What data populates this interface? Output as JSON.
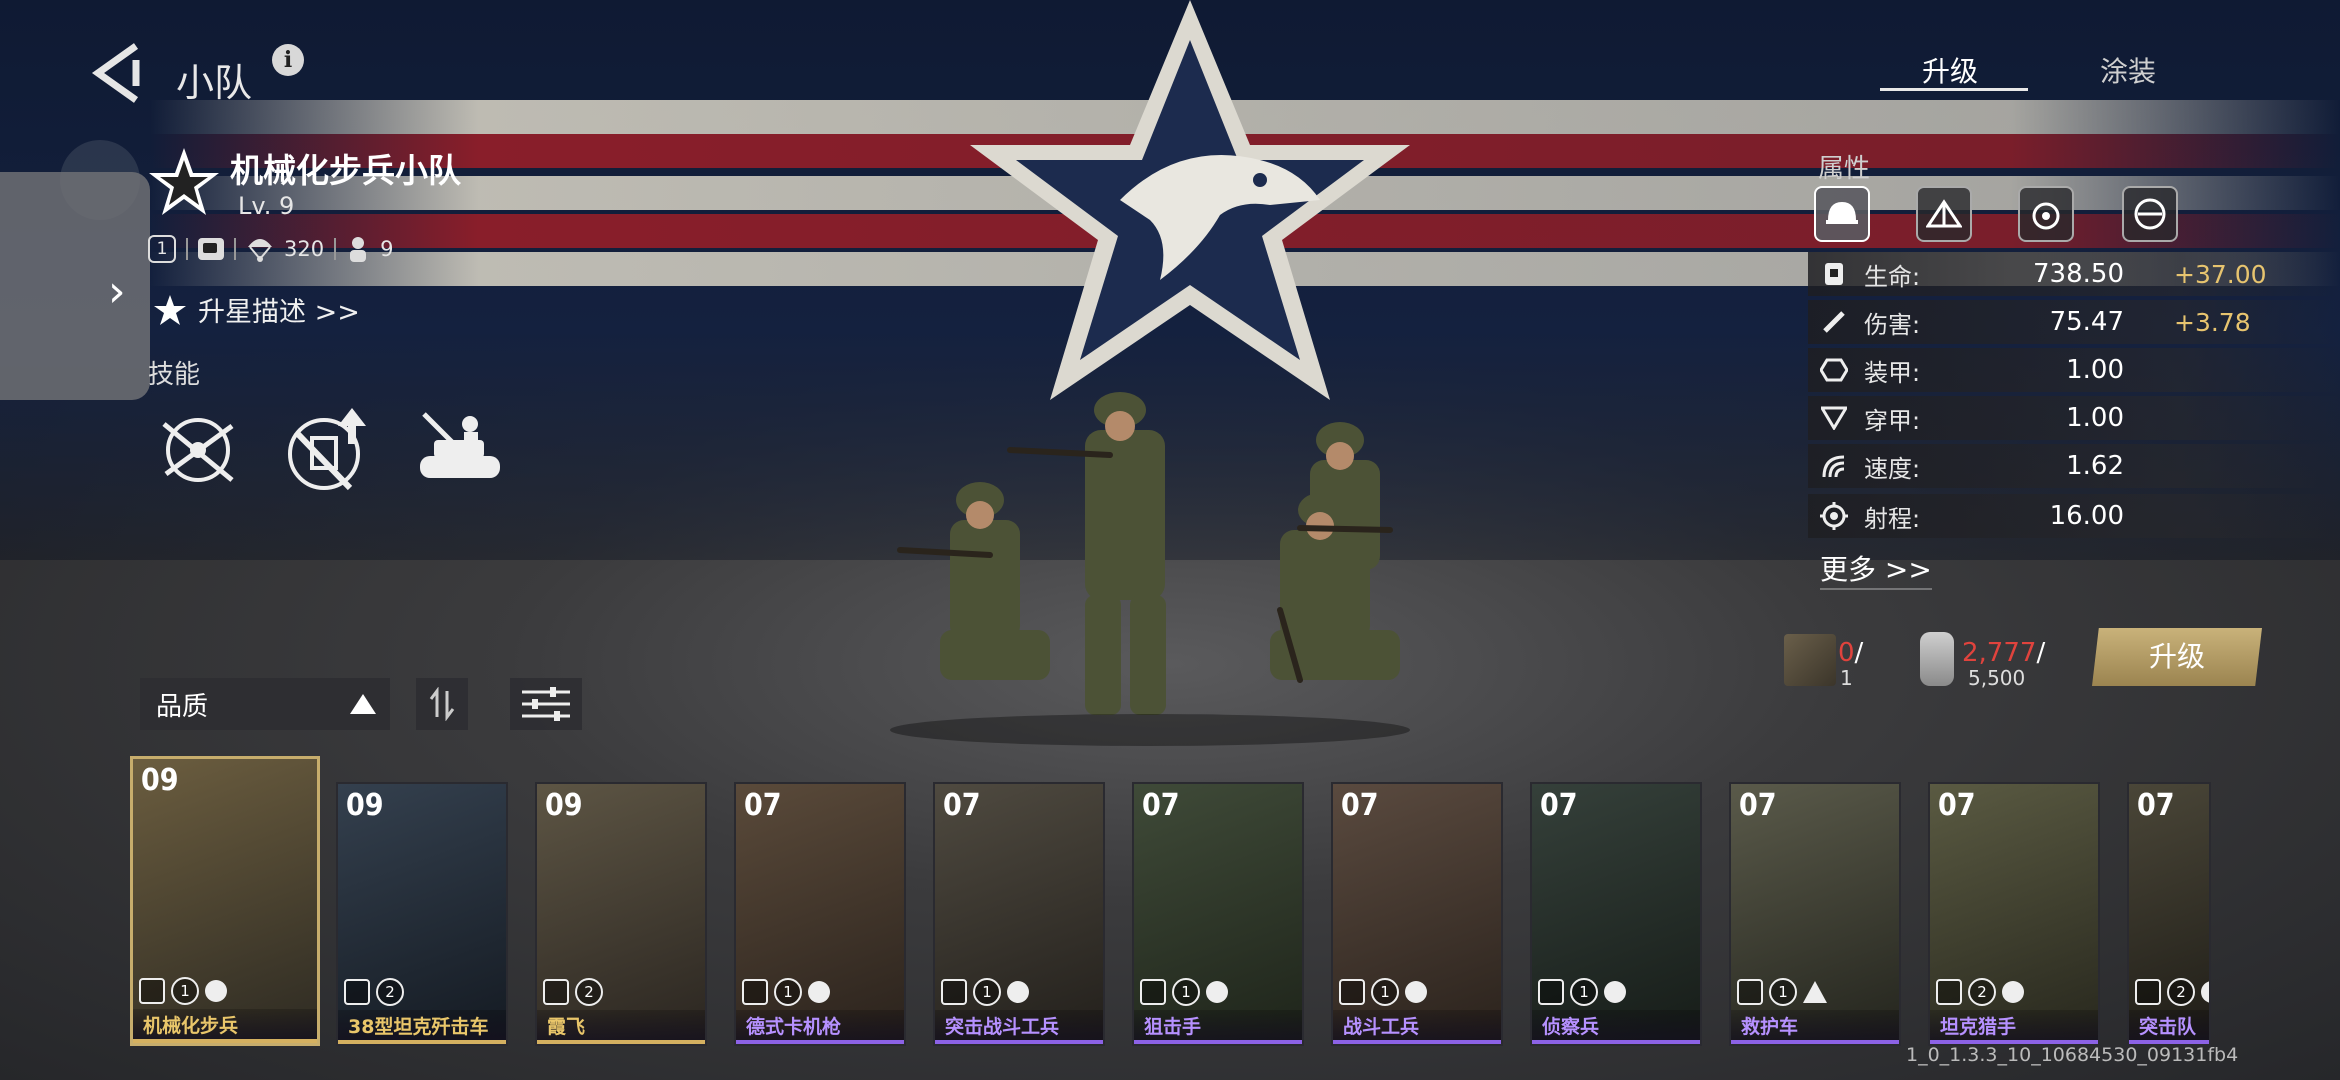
{
  "header": {
    "title": "小队",
    "info": "i"
  },
  "unit": {
    "name": "机械化步兵小队",
    "level": "Lv. 9",
    "rank_badge": "1",
    "airdrop_count": "320",
    "soldier_count": "9",
    "star_desc": "升星描述 >>",
    "skills_title": "技能"
  },
  "skills": [
    {
      "icon": "crossed-rifle-skill-icon"
    },
    {
      "icon": "upgrade-weapons-skill-icon"
    },
    {
      "icon": "tank-rider-skill-icon"
    }
  ],
  "tabs": {
    "upgrade": "升级",
    "paint": "涂装"
  },
  "attributes": {
    "title": "属性",
    "tabs": [
      "helmet-icon",
      "tent-icon",
      "target-icon",
      "rifle-icon"
    ],
    "rows": [
      {
        "icon": "health-icon",
        "name": "生命:",
        "value": "738.50",
        "bonus": "+37.00"
      },
      {
        "icon": "damage-icon",
        "name": "伤害:",
        "value": "75.47",
        "bonus": "+3.78"
      },
      {
        "icon": "armor-icon",
        "name": "装甲:",
        "value": "1.00",
        "bonus": ""
      },
      {
        "icon": "penetration-icon",
        "name": "穿甲:",
        "value": "1.00",
        "bonus": ""
      },
      {
        "icon": "speed-icon",
        "name": "速度:",
        "value": "1.62",
        "bonus": ""
      },
      {
        "icon": "range-icon",
        "name": "射程:",
        "value": "16.00",
        "bonus": ""
      }
    ],
    "more": "更多 >>"
  },
  "cost": {
    "card_have": "0",
    "card_sep": "/",
    "card_need": "1",
    "dogtag_have": "2,777",
    "dogtag_sep": "/",
    "dogtag_need": "5,500",
    "button": "升级"
  },
  "filter": {
    "sort_label": "品质"
  },
  "cards": [
    {
      "level": "09",
      "class_icon": "infantry-icon",
      "count": "1",
      "flag": true,
      "name": "机械化步兵",
      "rarity": "gold",
      "selected": true
    },
    {
      "level": "09",
      "class_icon": "tank-icon",
      "count": "2",
      "flag": false,
      "name": "38型坦克歼击车",
      "rarity": "gold"
    },
    {
      "level": "09",
      "class_icon": "tank-icon",
      "count": "2",
      "flag": false,
      "name": "霞飞",
      "rarity": "gold"
    },
    {
      "level": "07",
      "class_icon": "machinegun-icon",
      "count": "1",
      "flag": true,
      "name": "德式卡机枪",
      "rarity": "purple"
    },
    {
      "level": "07",
      "class_icon": "tools-icon",
      "count": "1",
      "flag": true,
      "name": "突击战斗工兵",
      "rarity": "purple"
    },
    {
      "level": "07",
      "class_icon": "sniper-icon",
      "count": "1",
      "flag": true,
      "name": "狙击手",
      "rarity": "purple"
    },
    {
      "level": "07",
      "class_icon": "tools-icon",
      "count": "1",
      "flag": true,
      "name": "战斗工兵",
      "rarity": "purple"
    },
    {
      "level": "07",
      "class_icon": "recon-icon",
      "count": "1",
      "flag": true,
      "name": "侦察兵",
      "rarity": "purple"
    },
    {
      "level": "07",
      "class_icon": "ambulance-icon",
      "count": "1",
      "flag": false,
      "warn": true,
      "name": "救护车",
      "rarity": "purple"
    },
    {
      "level": "07",
      "class_icon": "antitank-icon",
      "count": "2",
      "flag": true,
      "name": "坦克猎手",
      "rarity": "purple"
    },
    {
      "level": "07",
      "class_icon": "assault-icon",
      "count": "2",
      "flag": true,
      "name": "突击队",
      "rarity": "purple"
    }
  ],
  "version": "1_0_1.3.3_10_10684530_09131fb4",
  "colors": {
    "gold": "#d4b060",
    "purple": "#8c62e6",
    "bonus": "#e7c46f",
    "red": "#e0433d"
  }
}
